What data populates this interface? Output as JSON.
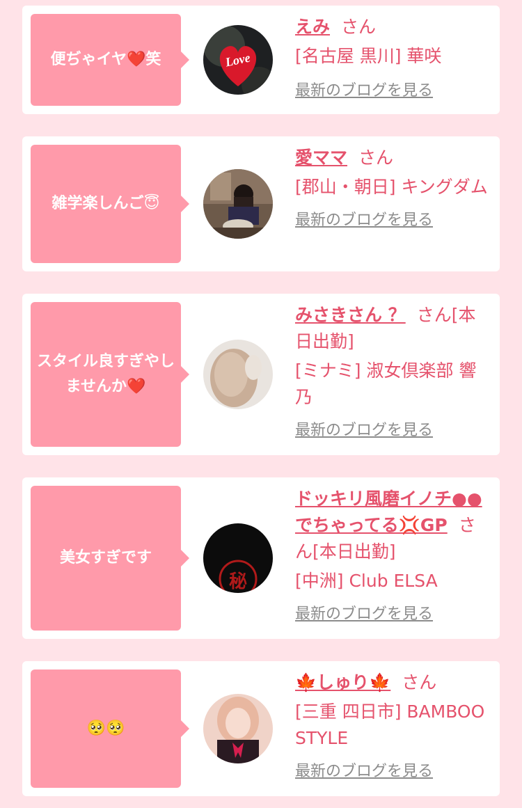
{
  "entries": [
    {
      "comment": "便ぢゃイヤ❤️笑",
      "name": "えみ",
      "suffix": "さん",
      "shop": "[名古屋 黒川] 華咲",
      "blog_link": "最新のブログを見る",
      "avatar_label": "Love"
    },
    {
      "comment": "雑学楽しんご😇",
      "name": "愛ママ",
      "suffix": "さん",
      "shop": "[郡山・朝日] キングダム",
      "blog_link": "最新のブログを見る"
    },
    {
      "comment": "スタイル良すぎやしませんか❤️",
      "name": "みさきさん ？",
      "suffix": "さん[本日出勤]",
      "shop": "[ミナミ] 淑女倶楽部 響乃",
      "blog_link": "最新のブログを見る"
    },
    {
      "comment": "美女すぎです",
      "name": "ドッキリ風磨イノチ●●でちゃってる💢GP",
      "suffix": "さん[本日出勤]",
      "shop": "[中洲] Club ELSA",
      "blog_link": "最新のブログを見る",
      "avatar_label": "秘"
    },
    {
      "comment": "🥺🥺",
      "name": "🍁しゅり🍁",
      "suffix": "さん",
      "shop": "[三重 四日市] BAMBOO STYLE",
      "blog_link": "最新のブログを見る"
    }
  ],
  "colors": {
    "page_bg": "#ffe3e8",
    "bubble": "#ff9aaa",
    "accent": "#e5526c",
    "link_gray": "#8c8c8c"
  }
}
